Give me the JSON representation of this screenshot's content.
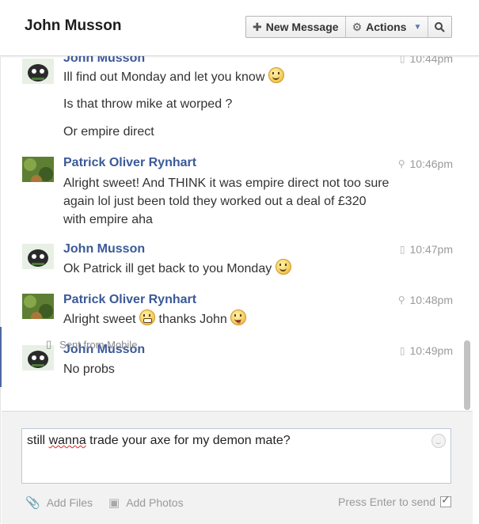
{
  "header": {
    "title": "John Musson",
    "new_message_label": "New Message",
    "actions_label": "Actions",
    "icons": {
      "new_message": "plus-icon",
      "actions": "gear-icon",
      "search": "search-icon"
    }
  },
  "messages": [
    {
      "sender": "John Musson",
      "time": "10:44pm",
      "source": "mobile",
      "lines": [
        "Ill find out Monday and let you know",
        "Is that throw mike at worped ?",
        "Or empire direct"
      ]
    },
    {
      "sender": "Patrick Oliver Rynhart",
      "time": "10:46pm",
      "source": "location",
      "lines": [
        "Alright sweet! And THINK it was empire direct not too sure",
        "again lol just been told they worked out a deal of £320",
        "with empire aha"
      ]
    },
    {
      "sender": "John Musson",
      "time": "10:47pm",
      "source": "mobile",
      "lines": [
        "Ok Patrick ill get back to you Monday"
      ]
    },
    {
      "sender": "Patrick Oliver Rynhart",
      "time": "10:48pm",
      "source": "location",
      "lines": [
        "Alright sweet",
        "thanks John"
      ]
    },
    {
      "sender": "John Musson",
      "time": "10:49pm",
      "source": "mobile",
      "lines": [
        "No probs"
      ]
    }
  ],
  "sent_from": "Sent from Mobile",
  "composer": {
    "text_before": "still ",
    "text_misspelled": "wanna",
    "text_after": " trade your axe for my demon mate?",
    "add_files_label": "Add Files",
    "add_photos_label": "Add Photos",
    "press_enter_label": "Press Enter to send",
    "press_enter_checked": true
  },
  "colors": {
    "sender_name": "#3b5998",
    "accent_bar": "#4e69a2",
    "composer_bg": "#f2f2f2"
  }
}
